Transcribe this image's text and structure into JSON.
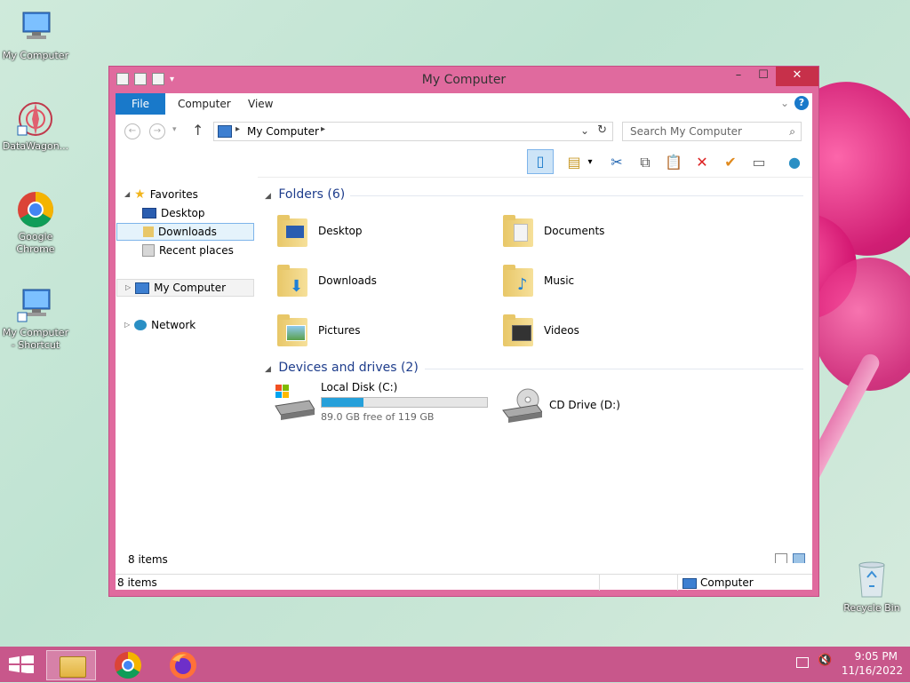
{
  "desktop": {
    "icons": [
      {
        "label": "My Computer"
      },
      {
        "label": "DataWagon..."
      },
      {
        "label": "Google Chrome"
      },
      {
        "label": "My Computer - Shortcut"
      }
    ],
    "recycle_bin": {
      "label": "Recycle Bin"
    }
  },
  "window": {
    "title": "My Computer",
    "tabs": [
      {
        "label": "File"
      },
      {
        "label": "Computer"
      },
      {
        "label": "View"
      }
    ],
    "address": {
      "path": "My Computer"
    },
    "search": {
      "placeholder": "Search My Computer"
    },
    "nav": {
      "favorites": "Favorites",
      "items": [
        {
          "label": "Desktop"
        },
        {
          "label": "Downloads"
        },
        {
          "label": "Recent places"
        }
      ],
      "my_computer": "My Computer",
      "network": "Network"
    },
    "content": {
      "folders_header": "Folders (6)",
      "folders": [
        {
          "label": "Desktop"
        },
        {
          "label": "Documents"
        },
        {
          "label": "Downloads"
        },
        {
          "label": "Music"
        },
        {
          "label": "Pictures"
        },
        {
          "label": "Videos"
        }
      ],
      "devices_header": "Devices and drives (2)",
      "local_disk": {
        "label": "Local Disk (C:)",
        "free_text": "89.0 GB free of 119 GB",
        "used_fraction": 0.252
      },
      "cd_drive": {
        "label": "CD Drive (D:)"
      }
    },
    "status": {
      "items_count": "8 items",
      "items_count_bar": "8 items",
      "location": "Computer"
    }
  },
  "taskbar": {
    "time": "9:05 PM",
    "date": "11/16/2022"
  },
  "colors": {
    "accent": "#1979ca",
    "window_frame": "#e06a9e",
    "taskbar": "#c8578b",
    "close_button": "#c7304a",
    "progress": "#26a0da"
  }
}
